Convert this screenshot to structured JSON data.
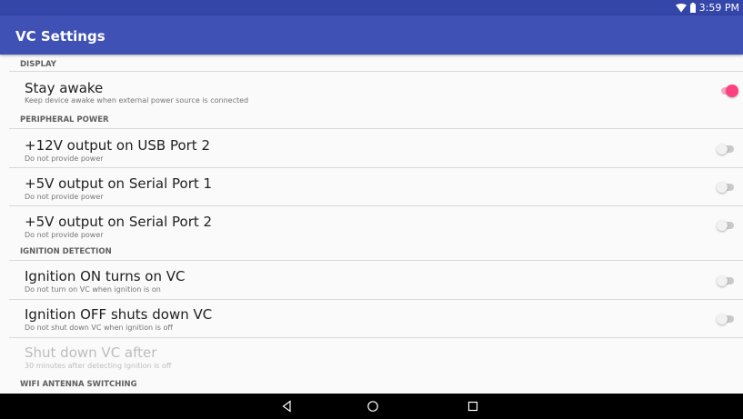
{
  "status": {
    "time": "3:59 PM",
    "wifi_icon": "wifi-icon",
    "battery_icon": "battery-icon"
  },
  "appbar": {
    "title": "VC Settings"
  },
  "sections": {
    "display": {
      "header": "DISPLAY",
      "items": [
        {
          "title": "Stay awake",
          "summary": "Keep device awake when external power source is connected",
          "enabled": true,
          "checked": true
        }
      ]
    },
    "peripheral_power": {
      "header": "PERIPHERAL POWER",
      "items": [
        {
          "title": "+12V output on USB Port 2",
          "summary": "Do not provide power",
          "enabled": true,
          "checked": false
        },
        {
          "title": "+5V output on Serial Port 1",
          "summary": "Do not provide power",
          "enabled": true,
          "checked": false
        },
        {
          "title": "+5V output on Serial Port 2",
          "summary": "Do not provide power",
          "enabled": true,
          "checked": false
        }
      ]
    },
    "ignition_detection": {
      "header": "IGNITION DETECTION",
      "items": [
        {
          "title": "Ignition ON turns on VC",
          "summary": "Do not turn on VC when ignition is on",
          "enabled": true,
          "checked": false
        },
        {
          "title": "Ignition OFF shuts down VC",
          "summary": "Do not shut down VC when ignition is off",
          "enabled": true,
          "checked": false
        },
        {
          "title": "Shut down VC after",
          "summary": "30 minutes after detecting ignition is off",
          "enabled": false
        }
      ]
    },
    "wifi_antenna": {
      "header": "WIFI ANTENNA SWITCHING"
    }
  },
  "navbar": {
    "back_icon": "back-icon",
    "home_icon": "home-icon",
    "recents_icon": "recents-icon"
  }
}
